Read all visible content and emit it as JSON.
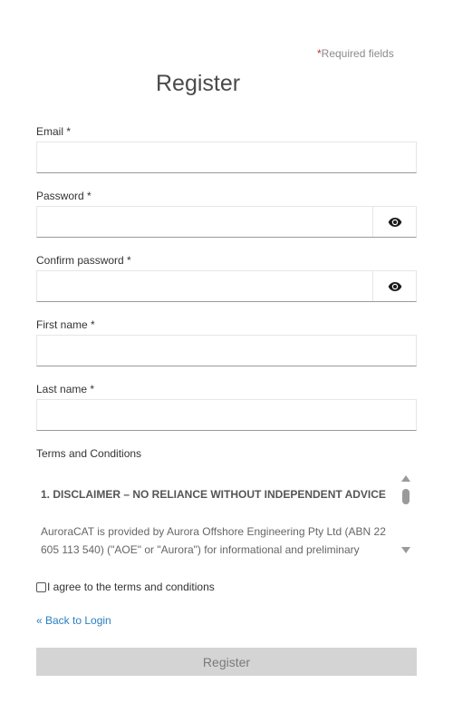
{
  "required_note": {
    "star": "*",
    "text": "Required fields"
  },
  "title": "Register",
  "fields": {
    "email": {
      "label": "Email *",
      "value": ""
    },
    "password": {
      "label": "Password *",
      "value": ""
    },
    "confirm_password": {
      "label": "Confirm password *",
      "value": ""
    },
    "first_name": {
      "label": "First name *",
      "value": ""
    },
    "last_name": {
      "label": "Last name *",
      "value": ""
    }
  },
  "icons": {
    "password_toggle": "eye-icon",
    "confirm_password_toggle": "eye-icon"
  },
  "terms": {
    "heading": "Terms and Conditions",
    "section_title": "1. DISCLAIMER – NO RELIANCE WITHOUT INDEPENDENT ADVICE",
    "section_text": "AuroraCAT is provided by Aurora Offshore Engineering Pty Ltd (ABN 22 605 113 540) (\"AOE\" or \"Aurora\") for informational and preliminary"
  },
  "agree_label": "I agree to the terms and conditions",
  "back_link": "« Back to Login",
  "register_button": "Register",
  "colors": {
    "link": "#2a7fc1",
    "required_star": "#c0392b",
    "button_disabled_bg": "#d4d4d4",
    "button_disabled_text": "#7a7a7a"
  }
}
